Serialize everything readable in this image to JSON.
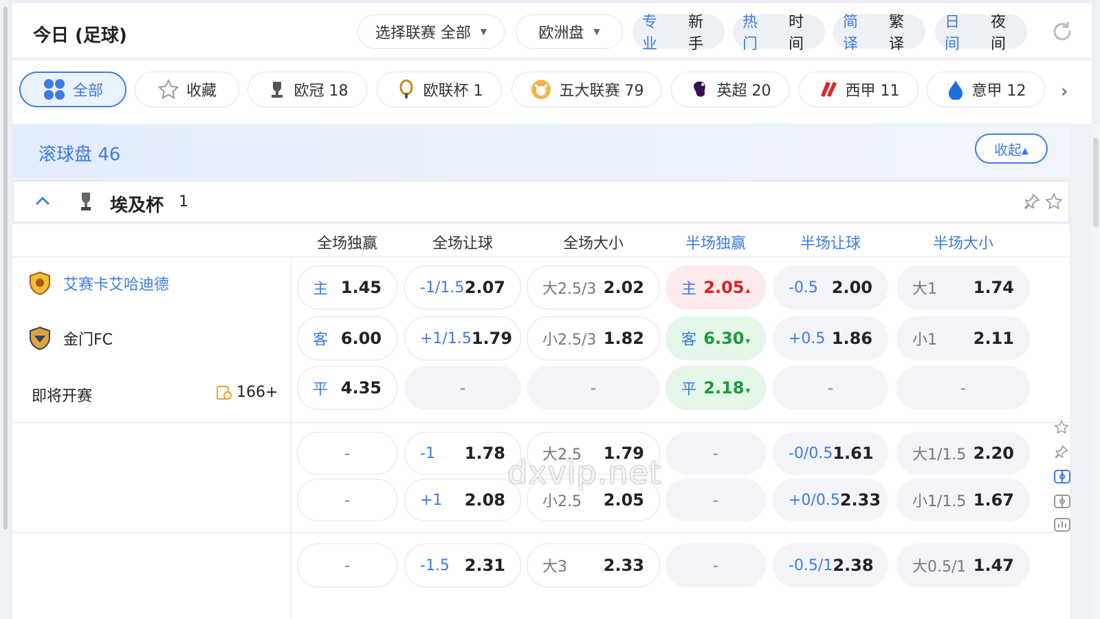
{
  "header": {
    "title": "今日 (足球)",
    "league_select": "选择联赛 全部",
    "odds_type": "欧洲盘",
    "toggles": [
      {
        "a": "专业",
        "b": "新手"
      },
      {
        "a": "热门",
        "b": "时间"
      },
      {
        "a": "简译",
        "b": "繁译"
      },
      {
        "a": "日间",
        "b": "夜间"
      }
    ]
  },
  "leagues": [
    {
      "label": "全部",
      "icon": "grid-icon"
    },
    {
      "label": "收藏",
      "icon": "star-outline-icon"
    },
    {
      "label": "欧冠 18",
      "icon": "champions-league-icon"
    },
    {
      "label": "欧联杯 1",
      "icon": "europa-league-icon"
    },
    {
      "label": "五大联赛 79",
      "icon": "top-five-leagues-icon"
    },
    {
      "label": "英超 20",
      "icon": "premier-league-icon"
    },
    {
      "label": "西甲 11",
      "icon": "la-liga-icon"
    },
    {
      "label": "意甲 12",
      "icon": "serie-a-icon"
    }
  ],
  "section": {
    "title": "滚球盘 46",
    "collapse": "收起▴"
  },
  "league_group": {
    "name": "埃及杯",
    "count": "1"
  },
  "columns": [
    "全场独赢",
    "全场让球",
    "全场大小",
    "半场独赢",
    "半场让球",
    "半场大小"
  ],
  "match": {
    "home": "艾赛卡艾哈迪德",
    "away": "金门FC",
    "status": "即将开赛",
    "more_markets": "166+"
  },
  "odds": {
    "r1": [
      {
        "lb": "主",
        "od": "1.45"
      },
      {
        "lb": "-1/1.5",
        "od": "2.07"
      },
      {
        "lb": "大2.5/3",
        "od": "2.02"
      },
      {
        "lb": "主",
        "od": "2.05",
        "arrow": "▴"
      },
      {
        "lb": "-0.5",
        "od": "2.00"
      },
      {
        "lb": "大1",
        "od": "1.74"
      }
    ],
    "r2": [
      {
        "lb": "客",
        "od": "6.00"
      },
      {
        "lb": "+1/1.5",
        "od": "1.79"
      },
      {
        "lb": "小2.5/3",
        "od": "1.82"
      },
      {
        "lb": "客",
        "od": "6.30",
        "arrow": "▾"
      },
      {
        "lb": "+0.5",
        "od": "1.86"
      },
      {
        "lb": "小1",
        "od": "2.11"
      }
    ],
    "r3": [
      {
        "lb": "平",
        "od": "4.35"
      },
      {
        "empty": "-"
      },
      {
        "empty": "-"
      },
      {
        "lb": "平",
        "od": "2.18",
        "arrow": "▾"
      },
      {
        "empty": "-"
      },
      {
        "empty": "-"
      }
    ],
    "r4": [
      {
        "empty": "-"
      },
      {
        "lb": "-1",
        "od": "1.78"
      },
      {
        "lb": "大2.5",
        "od": "1.79"
      },
      {
        "empty": "-"
      },
      {
        "lb": "-0/0.5",
        "od": "1.61"
      },
      {
        "lb": "大1/1.5",
        "od": "2.20"
      }
    ],
    "r5": [
      {
        "empty": "-"
      },
      {
        "lb": "+1",
        "od": "2.08"
      },
      {
        "lb": "小2.5",
        "od": "2.05"
      },
      {
        "empty": "-"
      },
      {
        "lb": "+0/0.5",
        "od": "2.33"
      },
      {
        "lb": "小1/1.5",
        "od": "1.67"
      }
    ],
    "r6": [
      {
        "empty": "-"
      },
      {
        "lb": "-1.5",
        "od": "2.31"
      },
      {
        "lb": "大3",
        "od": "2.33"
      },
      {
        "empty": "-"
      },
      {
        "lb": "-0.5/1",
        "od": "2.38"
      },
      {
        "lb": "大0.5/1",
        "od": "1.47"
      }
    ]
  },
  "watermark": "dxvip.net",
  "colors": {
    "accent": "#3d7be6",
    "up": "#e02020",
    "down": "#1f9a3a"
  }
}
